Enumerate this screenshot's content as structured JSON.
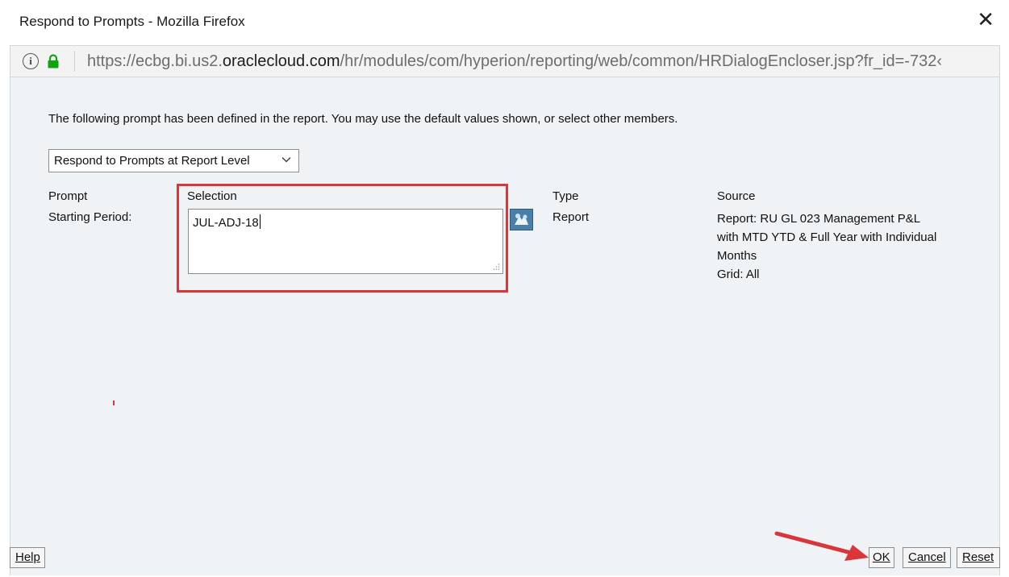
{
  "window": {
    "title": "Respond to Prompts - Mozilla Firefox",
    "close_label": "✕"
  },
  "urlbar": {
    "info_icon": "i",
    "url_prefix": "https://ecbg.bi.us2.",
    "url_domain": "oraclecloud.com",
    "url_rest": "/hr/modules/com/hyperion/reporting/web/common/HRDialogEncloser.jsp?fr_id=-732‹"
  },
  "dialog": {
    "intro_text": "The following prompt has been defined in the report. You may use the default values shown, or select other members.",
    "level_select": {
      "value": "Respond to Prompts at Report Level"
    },
    "headers": {
      "prompt": "Prompt",
      "selection": "Selection",
      "type": "Type",
      "source": "Source"
    },
    "row": {
      "prompt": "Starting Period:",
      "selection": "JUL-ADJ-18",
      "type": "Report",
      "source_lines": [
        "Report: RU GL 023 Management P&L",
        "with MTD YTD & Full Year with Individual",
        "Months",
        "Grid: All"
      ]
    }
  },
  "buttons": {
    "help": "Help",
    "ok": "OK",
    "cancel": "Cancel",
    "reset": "Reset"
  },
  "colors": {
    "highlight": "#d9363a",
    "lock": "#12a312",
    "member_button": "#4a7fa8"
  }
}
